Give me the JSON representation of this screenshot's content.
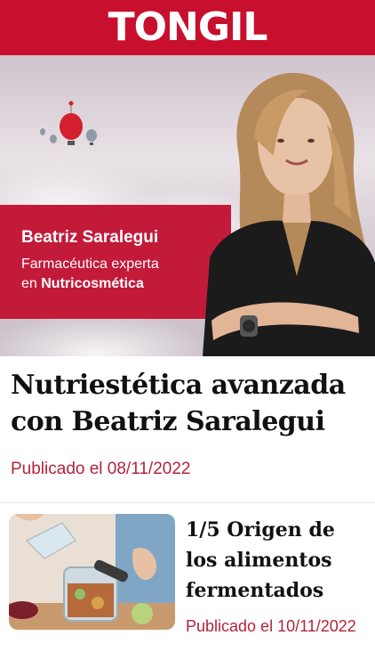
{
  "header": {
    "logo_text": "TONGIL",
    "bar_color": "#c8102e"
  },
  "hero": {
    "name": "Beatriz Saralegui",
    "role_line1": "Farmacéutica experta",
    "role_line2_prefix": "en ",
    "role_line2_bold": "Nutricosmética",
    "band_color": "#c31a3a",
    "image": "portrait-photo"
  },
  "main_article": {
    "title": "Nutriestética avanzada con Beatriz Saralegui",
    "published": "Publicado el 08/11/2022"
  },
  "list_article": {
    "title": "1/5 Origen de los alimentos fermentados",
    "published": "Publicado el 10/11/2022",
    "thumbnail": "fermented-vegetables-jar-photo"
  },
  "accent_color": "#b3243b"
}
